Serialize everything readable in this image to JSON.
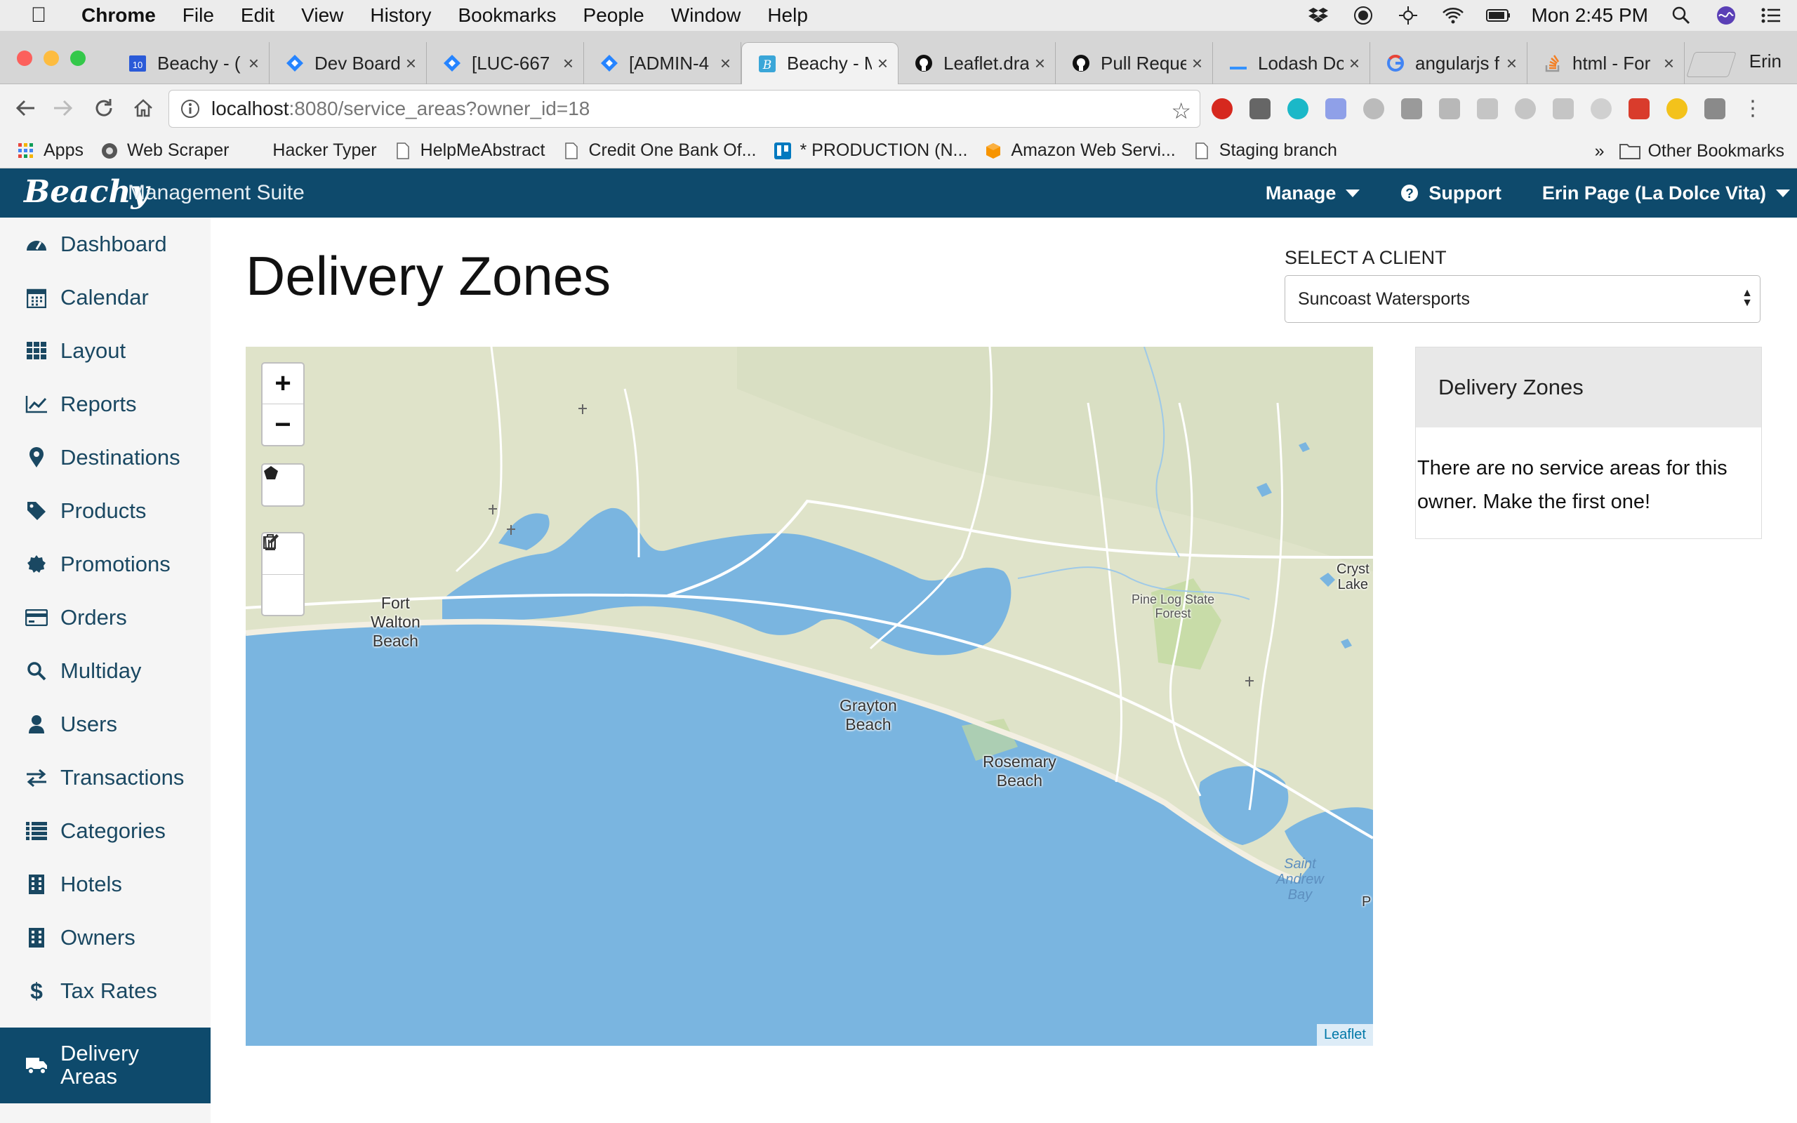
{
  "menubar": {
    "app": "Chrome",
    "items": [
      "File",
      "Edit",
      "View",
      "History",
      "Bookmarks",
      "People",
      "Window",
      "Help"
    ],
    "clock": "Mon 2:45 PM"
  },
  "tabs": [
    {
      "title": "Beachy - (",
      "favicon": "calendar-icon"
    },
    {
      "title": "Dev Board",
      "favicon": "jira-icon"
    },
    {
      "title": "[LUC-667",
      "favicon": "jira-icon"
    },
    {
      "title": "[ADMIN-4",
      "favicon": "jira-icon"
    },
    {
      "title": "Beachy - M",
      "favicon": "beachy-icon",
      "active": true
    },
    {
      "title": "Leaflet.dra",
      "favicon": "github-icon"
    },
    {
      "title": "Pull Reque",
      "favicon": "github-icon"
    },
    {
      "title": "Lodash Do",
      "favicon": "lodash-icon"
    },
    {
      "title": "angularjs f",
      "favicon": "google-icon"
    },
    {
      "title": "html - For",
      "favicon": "stackoverflow-icon"
    }
  ],
  "profile": "Erin",
  "omnibox": {
    "host": "localhost",
    "rest": ":8080/service_areas?owner_id=18"
  },
  "bookmarks": [
    {
      "label": "Apps",
      "icon": "apps-grid-icon"
    },
    {
      "label": "Web Scraper",
      "icon": "web-scraper-icon"
    },
    {
      "label": "Hacker Typer",
      "icon": "blank-icon"
    },
    {
      "label": "HelpMeAbstract",
      "icon": "page-icon"
    },
    {
      "label": "Credit One Bank Of...",
      "icon": "page-icon"
    },
    {
      "label": "* PRODUCTION (N...",
      "icon": "trello-icon"
    },
    {
      "label": "Amazon Web Servi...",
      "icon": "aws-icon"
    },
    {
      "label": "Staging branch",
      "icon": "page-icon"
    }
  ],
  "bookmarks_overflow": "»",
  "other_bookmarks": "Other Bookmarks",
  "app": {
    "brand": "Beachy",
    "suite": "Management Suite",
    "nav": {
      "manage": "Manage",
      "support": "Support",
      "user": "Erin Page (La Dolce Vita)"
    }
  },
  "sidebar": [
    {
      "label": "Dashboard",
      "icon": "dashboard-icon"
    },
    {
      "label": "Calendar",
      "icon": "calendar-icon"
    },
    {
      "label": "Layout",
      "icon": "grid-icon"
    },
    {
      "label": "Reports",
      "icon": "line-chart-icon"
    },
    {
      "label": "Destinations",
      "icon": "map-marker-icon"
    },
    {
      "label": "Products",
      "icon": "tag-icon"
    },
    {
      "label": "Promotions",
      "icon": "badge-icon"
    },
    {
      "label": "Orders",
      "icon": "credit-card-icon"
    },
    {
      "label": "Multiday",
      "icon": "search-icon"
    },
    {
      "label": "Users",
      "icon": "user-icon"
    },
    {
      "label": "Transactions",
      "icon": "exchange-icon"
    },
    {
      "label": "Categories",
      "icon": "list-icon"
    },
    {
      "label": "Hotels",
      "icon": "building-icon"
    },
    {
      "label": "Owners",
      "icon": "building-icon"
    },
    {
      "label": "Tax Rates",
      "icon": "dollar-icon"
    },
    {
      "label": "Delivery Areas",
      "icon": "truck-icon",
      "active": true
    }
  ],
  "page": {
    "title": "Delivery Zones",
    "client_label": "SELECT A CLIENT",
    "client_value": "Suncoast Watersports"
  },
  "map": {
    "zoom_in": "+",
    "zoom_out": "−",
    "attribution": "Leaflet",
    "labels": [
      {
        "text": "Fort\nWalton\nBeach",
        "kind": "town"
      },
      {
        "text": "Grayton\nBeach",
        "kind": "town"
      },
      {
        "text": "Rosemary\nBeach",
        "kind": "town"
      },
      {
        "text": "Pine Log State\nForest",
        "kind": "park"
      },
      {
        "text": "Saint\nAndrew\nBay",
        "kind": "water"
      },
      {
        "text": "Cryst\nLake",
        "kind": "town"
      },
      {
        "text": "P",
        "kind": "town"
      }
    ]
  },
  "panel": {
    "title": "Delivery Zones",
    "empty_message": "There are no service areas for this owner. Make the first one!"
  },
  "colors": {
    "brand": "#0e4a6c",
    "sea": "#7ab5e0",
    "land": "#dfe3c9"
  }
}
